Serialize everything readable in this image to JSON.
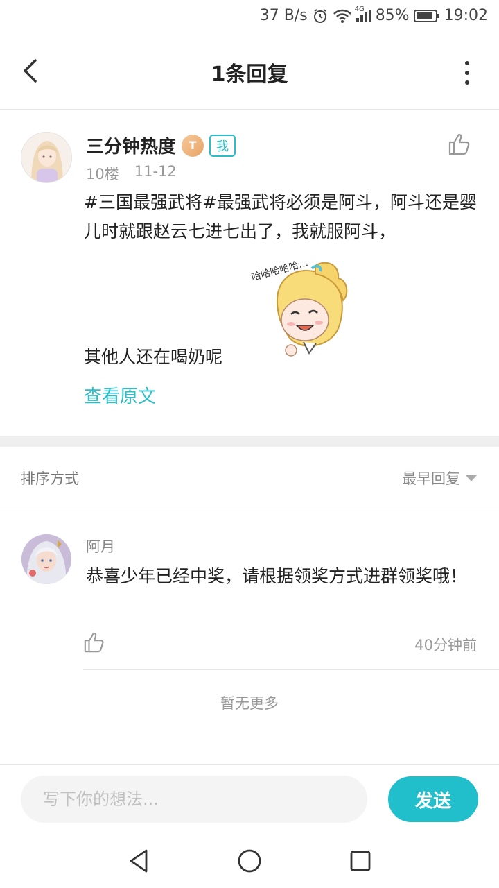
{
  "status_bar": {
    "speed": "37 B/s",
    "network": "4G",
    "battery": "85%",
    "time": "19:02"
  },
  "header": {
    "title": "1条回复"
  },
  "post": {
    "author": "三分钟热度",
    "level_badge": "T",
    "me_badge": "我",
    "floor": "10楼",
    "date": "11-12",
    "text_line1": "#三国最强武将#最强武将必须是阿斗，阿斗还是婴儿时就跟赵云七进七出了，我就服阿斗，",
    "sticker_text": "哈哈哈哈哈…",
    "text_line2": "其他人还在喝奶呢",
    "view_original": "查看原文"
  },
  "sort": {
    "label": "排序方式",
    "selected": "最早回复"
  },
  "reply": {
    "author": "阿月",
    "text": "恭喜少年已经中奖，请根据领奖方式进群领奖哦！",
    "time": "40分钟前"
  },
  "footer_note": "暂无更多",
  "composer": {
    "placeholder": "写下你的想法...",
    "send_label": "发送"
  },
  "colors": {
    "accent": "#21bfcb",
    "badge_orange": "#e8a365"
  }
}
